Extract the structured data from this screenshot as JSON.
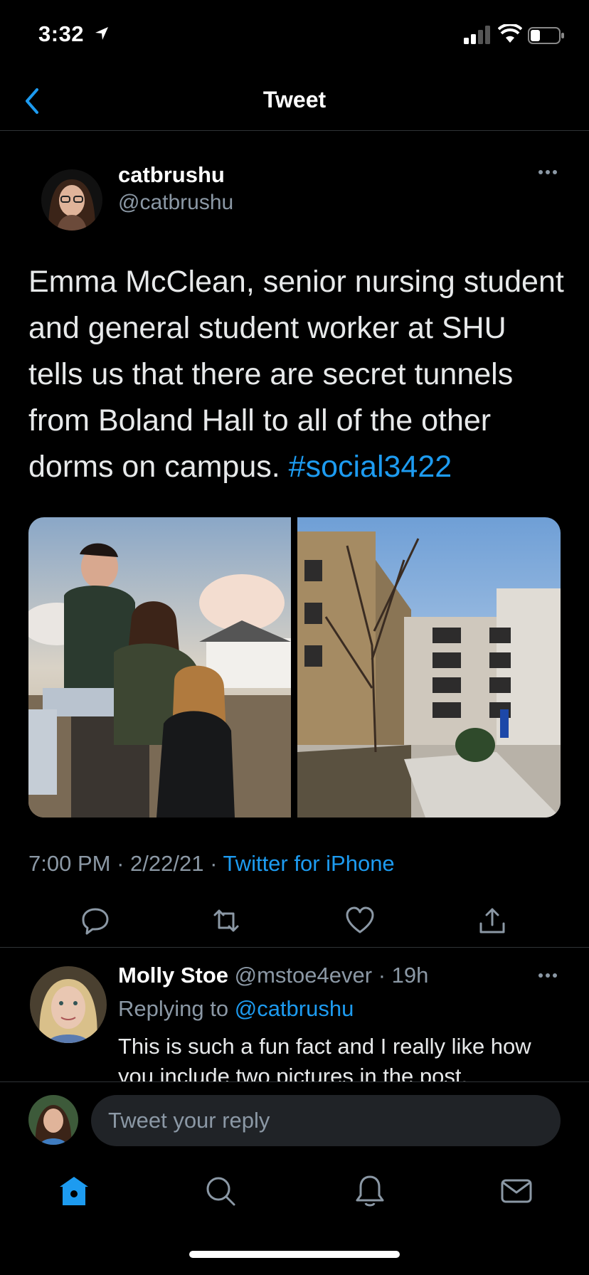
{
  "status_bar": {
    "time": "3:32",
    "icons": [
      "location-arrow-icon",
      "signal-bars-icon",
      "wifi-icon",
      "battery-icon"
    ]
  },
  "nav": {
    "title": "Tweet",
    "back_icon": "chevron-left-icon"
  },
  "tweet": {
    "author_name": "catbrushu",
    "author_handle": "@catbrushu",
    "text": "Emma McClean, senior nursing student and general student worker at SHU tells us that there are secret tunnels from Boland Hall to all of the other dorms on campus. ",
    "hashtag": "#social3422",
    "time": "7:00 PM",
    "date": "2/22/21",
    "source": "Twitter for iPhone",
    "separator": " · ",
    "actions": [
      "reply-icon",
      "retweet-icon",
      "like-icon",
      "share-icon"
    ]
  },
  "reply": {
    "name": "Molly Stoe",
    "handle": "@mstoe4ever",
    "age": "19h",
    "replying_label": "Replying to ",
    "replying_to": "@catbrushu",
    "text": "This is such a fun fact and I really like how you include two pictures in the post."
  },
  "composer": {
    "placeholder": "Tweet your reply"
  },
  "tabbar": {
    "tabs": [
      "home-icon",
      "search-icon",
      "notifications-icon",
      "messages-icon"
    ],
    "active": "home-icon"
  },
  "colors": {
    "accent": "#1d9bf0",
    "secondary_text": "#8b98a5",
    "divider": "#2f3336",
    "background": "#000000"
  }
}
